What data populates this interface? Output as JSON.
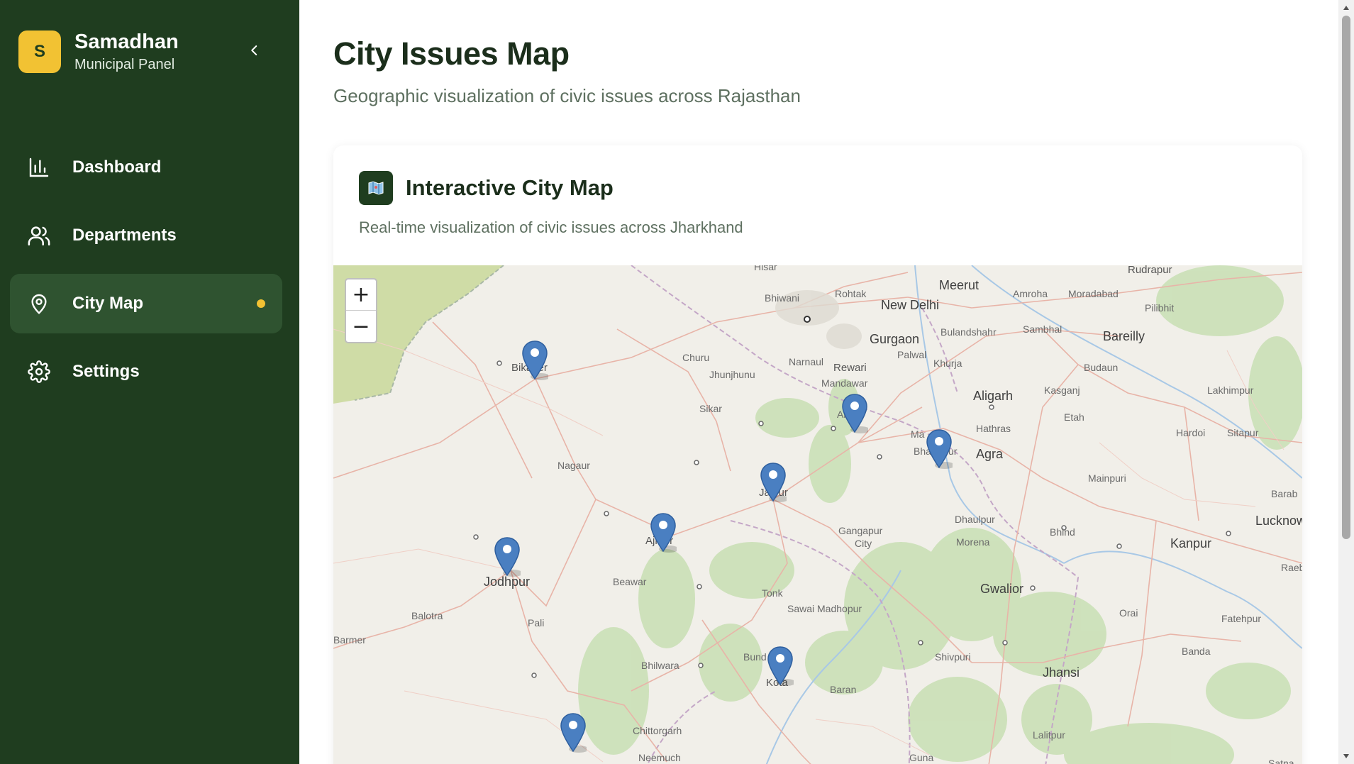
{
  "brand": {
    "logo_letter": "S",
    "name": "Samadhan",
    "subtitle": "Municipal Panel"
  },
  "sidebar": {
    "collapse_icon": "chevron-left-icon",
    "items": [
      {
        "label": "Dashboard",
        "icon": "bar-chart-icon",
        "active": false
      },
      {
        "label": "Departments",
        "icon": "users-icon",
        "active": false
      },
      {
        "label": "City Map",
        "icon": "map-pin-icon",
        "active": true
      },
      {
        "label": "Settings",
        "icon": "gear-icon",
        "active": false
      }
    ]
  },
  "page": {
    "title": "City Issues Map",
    "subtitle": "Geographic visualization of civic issues across Rajasthan"
  },
  "card": {
    "icon": "map-icon",
    "title": "Interactive City Map",
    "description": "Real-time visualization of civic issues across Jharkhand"
  },
  "map": {
    "zoom_in": "+",
    "zoom_out": "−",
    "labels": {
      "hisar": "Hisar",
      "rudrapur": "Rudrapur",
      "meerut": "Meerut",
      "bhiwani": "Bhiwani",
      "rohtak": "Rohtak",
      "new_delhi": "New Delhi",
      "amroha": "Amroha",
      "moradabad": "Moradabad",
      "pilibhit": "Pilibhit",
      "bulandshahr": "Bulandshahr",
      "sambhal": "Sambhal",
      "gurgaon": "Gurgaon",
      "bareilly": "Bareilly",
      "churu": "Churu",
      "narnaul": "Narnaul",
      "palwal": "Palwal",
      "khurja": "Khurja",
      "jhunjhunu": "Jhunjhunu",
      "rewari": "Rewari",
      "budaun": "Budaun",
      "bikaner": "Bikaner",
      "mandawar": "Mandawar",
      "aligarh": "Aligarh",
      "kasganj": "Kasganj",
      "lakhimpur": "Lakhimpur",
      "sikar": "Sikar",
      "alwar": "Alwar",
      "etah": "Etah",
      "hathras": "Hathras",
      "mathura": "Ma",
      "hardoi": "Hardoi",
      "sitapur": "Sitapur",
      "bharatpur": "Bharatpur",
      "agra": "Agra",
      "nagaur": "Nagaur",
      "jaipur": "Jaipur",
      "mainpuri": "Mainpuri",
      "barabanki": "Barab",
      "lucknow": "Lucknow",
      "dhaulpur": "Dhaulpur",
      "gangapur": "Gangapur",
      "gangapur_city": "City",
      "bhind": "Bhind",
      "ajmer": "Ajmer",
      "morena": "Morena",
      "kanpur": "Kanpur",
      "jodhpur": "Jodhpur",
      "beawar": "Beawar",
      "raebareli": "Raeb",
      "tonk": "Tonk",
      "gwalior": "Gwalior",
      "balotra": "Balotra",
      "pali": "Pali",
      "sawai_madhopur": "Sawai Madhopur",
      "orai": "Orai",
      "fatehpur": "Fatehpur",
      "barmer": "Barmer",
      "banda": "Banda",
      "shivpuri": "Shivpuri",
      "bundi": "Bund",
      "bhilwara": "Bhilwara",
      "jhansi": "Jhansi",
      "kota": "Kota",
      "baran": "Baran",
      "chittorgarh": "Chittorgarh",
      "lalitpur": "Lalitpur",
      "neemuch": "Neemuch",
      "guna": "Guna",
      "satna": "Satna"
    },
    "markers": [
      {
        "name": "Bikaner"
      },
      {
        "name": "Alwar"
      },
      {
        "name": "Bharatpur"
      },
      {
        "name": "Jaipur"
      },
      {
        "name": "Ajmer"
      },
      {
        "name": "Jodhpur"
      },
      {
        "name": "Kota"
      },
      {
        "name": "Udaipur"
      }
    ]
  },
  "colors": {
    "sidebar_bg": "#1f3d1f",
    "active_item_bg": "#2f5330",
    "accent": "#f2c233",
    "marker": "#4a7fc1"
  }
}
